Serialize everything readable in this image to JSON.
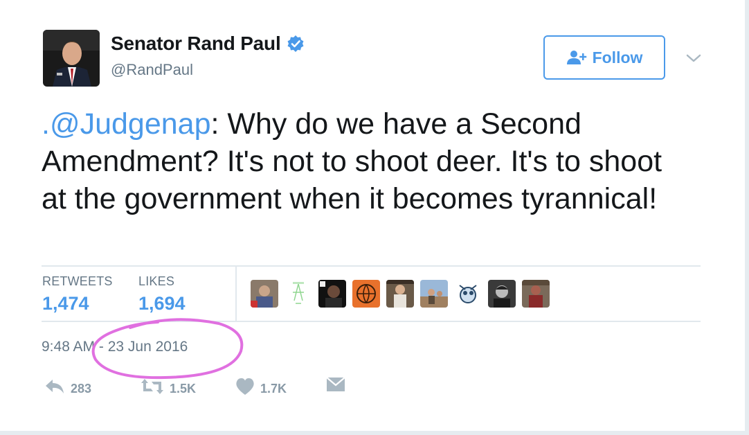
{
  "author": {
    "name": "Senator Rand Paul",
    "handle": "@RandPaul",
    "verified": true
  },
  "follow_button": {
    "label": "Follow",
    "icon": "add-user-icon"
  },
  "tweet": {
    "mention": ".@Judgenap",
    "text": ": Why do we have a Second Amendment? It's not to shoot deer. It's to shoot at the government when it becomes tyrannical!"
  },
  "stats": {
    "retweets_label": "RETWEETS",
    "retweets_value": "1,474",
    "likes_label": "LIKES",
    "likes_value": "1,694"
  },
  "timestamp": "9:48 AM - 23 Jun 2016",
  "actions": {
    "reply_count": "283",
    "retweet_count": "1.5K",
    "like_count": "1.7K"
  },
  "colors": {
    "accent": "#4a99e9",
    "secondary_text": "#657786",
    "annotation": "#e070e0"
  }
}
